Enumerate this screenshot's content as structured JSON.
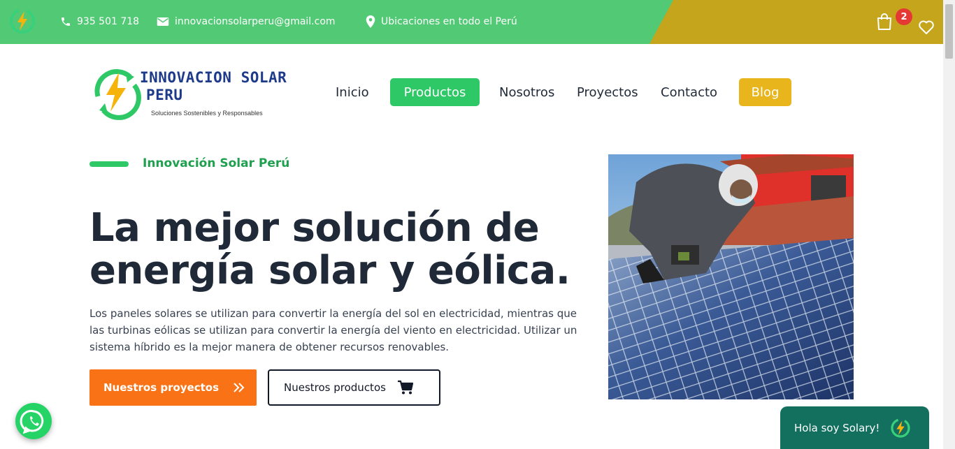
{
  "topbar": {
    "phone": "935 501 718",
    "email": "innovacionsolarperu@gmail.com",
    "location": "Ubicaciones en todo el Perú",
    "cart_count": "2",
    "icons": [
      "bolt-logo-icon",
      "phone-icon",
      "mail-icon",
      "location-pin-icon",
      "cart-bag-icon",
      "heart-icon"
    ]
  },
  "logo": {
    "line1": "INNOVACION SOLAR",
    "line2": "PERU",
    "tagline": "Soluciones Sostenibles y Responsables"
  },
  "nav": {
    "items": [
      {
        "label": "Inicio"
      },
      {
        "label": "Productos"
      },
      {
        "label": "Nosotros"
      },
      {
        "label": "Proyectos"
      },
      {
        "label": "Contacto"
      },
      {
        "label": "Blog"
      }
    ]
  },
  "hero": {
    "eyebrow": "Innovación Solar Perú",
    "title_line1": "La mejor solución de",
    "title_line2": "energía solar y eólica.",
    "text": "Los paneles solares se utilizan para convertir la energía del sol en electricidad, mientras que las turbinas eólicas se utilizan para convertir la energía del viento en electricidad. Utilizar un sistema híbrido es la mejor manera de obtener recursos renovables.",
    "btn_projects": "Nuestros proyectos",
    "btn_products": "Nuestros productos"
  },
  "chat": {
    "label": "Hola soy Solary!"
  },
  "colors": {
    "topbar_green": "#52c975",
    "topbar_gold": "#c4a51c",
    "accent_green": "#2ec866",
    "blog_gold": "#e9b51c",
    "orange_button": "#f97316",
    "chat_teal": "#13705f"
  }
}
